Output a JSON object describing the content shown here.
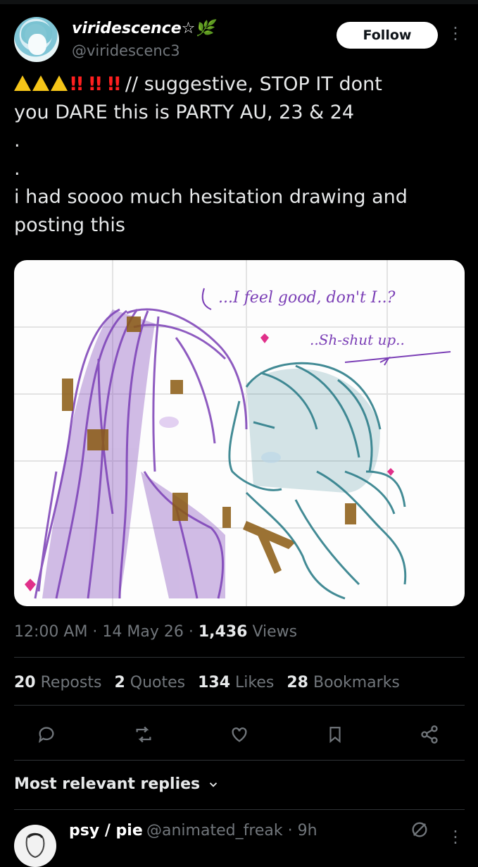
{
  "post": {
    "display_name": "viridescence☆🌿",
    "handle": "@viridescenc3",
    "follow_label": "Follow",
    "text_line1": "// suggestive, STOP IT dont",
    "text_line2": "you DARE this is PARTY AU, 23 & 24",
    "text_dot1": ".",
    "text_dot2": ".",
    "text_line3": "i had soooo much hesitation drawing and",
    "text_line4": "posting this",
    "warning_emojis": [
      "⚠️",
      "⚠️",
      "⚠️",
      "‼️",
      "‼️",
      "‼️"
    ]
  },
  "image": {
    "handwriting_1": "...I feel good, don't I..?",
    "handwriting_2": "..Sh-shut up..",
    "colors": {
      "purple": "#7b3fb6",
      "teal": "#2f7f8a",
      "brown": "#8a5a12",
      "pink": "#e0308a"
    }
  },
  "meta": {
    "time": "12:00 AM",
    "date": "14 May 26",
    "views_count": "1,436",
    "views_label": "Views"
  },
  "stats": {
    "reposts_count": "20",
    "reposts_label": "Reposts",
    "quotes_count": "2",
    "quotes_label": "Quotes",
    "likes_count": "134",
    "likes_label": "Likes",
    "bookmarks_count": "28",
    "bookmarks_label": "Bookmarks"
  },
  "actions": [
    "reply-icon",
    "repost-icon",
    "like-icon",
    "bookmark-icon",
    "share-icon"
  ],
  "replies": {
    "sort_label": "Most relevant replies",
    "first": {
      "name": "psy / pie",
      "handle": "@animated_freak",
      "time": "9h"
    }
  },
  "theme": {
    "background": "#000000",
    "text": "#e7e9ea",
    "muted": "#71767b",
    "divider": "#2f3336"
  }
}
